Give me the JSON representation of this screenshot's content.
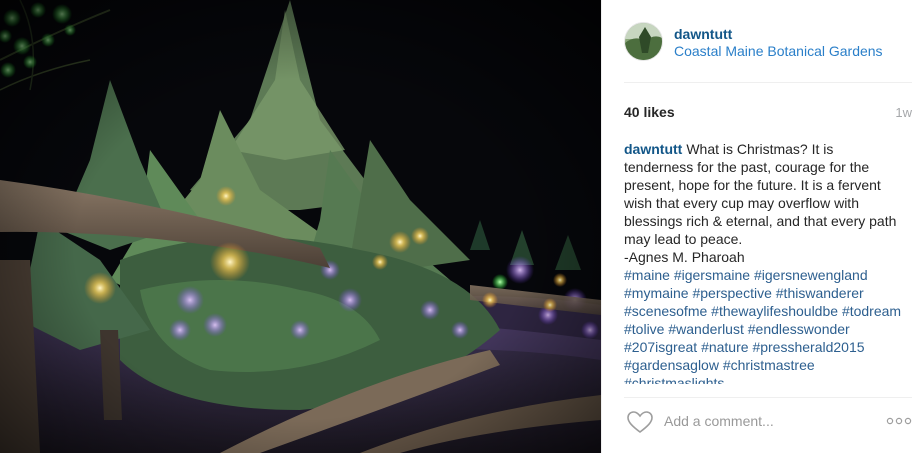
{
  "post": {
    "username": "dawntutt",
    "location": "Coastal Maine Botanical Gardens",
    "likes": "40 likes",
    "time": "1w",
    "caption_user": "dawntutt",
    "caption_text": "What is Christmas? It is tenderness for the past, courage for the present, hope for the future. It is a fervent wish that every cup may overflow with blessings rich & eternal, and that every path may lead to peace.\n-Agnes M. Pharoah",
    "hashtags": [
      "#maine",
      "#igersmaine",
      "#igersnewengland",
      "#mymaine",
      "#perspective",
      "#thiswanderer",
      "#scenesofme",
      "#thewaylifeshouldbe",
      "#todream",
      "#tolive",
      "#wanderlust",
      "#endlesswonder",
      "#207isgreat",
      "#nature",
      "#pressherald2015",
      "#gardensaglow",
      "#christmastree",
      "#christmaslights"
    ]
  },
  "comment": {
    "placeholder": "Add a comment..."
  },
  "icons": {
    "like": "heart-icon",
    "more": "more-options-icon",
    "avatar": "user-avatar"
  },
  "colors": {
    "username": "#125688",
    "link": "#2a7fc9",
    "muted": "#a5a7aa",
    "text": "#262626"
  }
}
